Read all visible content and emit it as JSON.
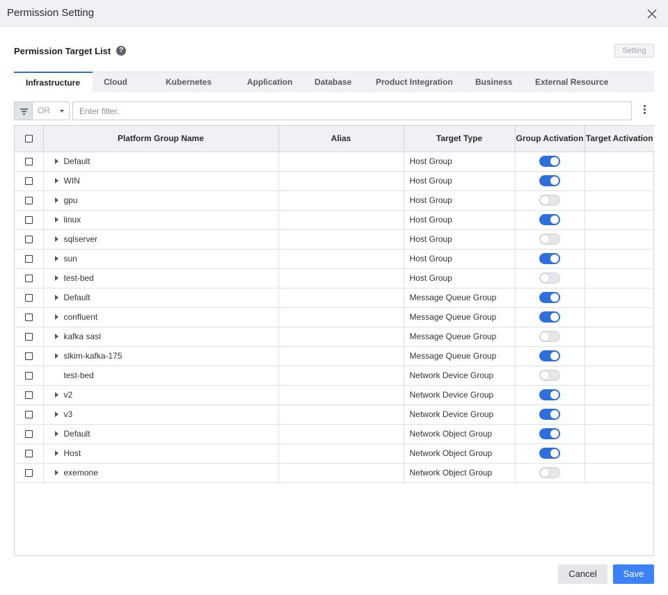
{
  "window": {
    "title": "Permission Setting"
  },
  "section": {
    "title": "Permission Target List",
    "setting_label": "Setting"
  },
  "tabs": [
    {
      "label": "Infrastructure",
      "active": true
    },
    {
      "label": "Cloud",
      "active": false
    },
    {
      "label": "Kubernetes",
      "active": false
    },
    {
      "label": "Application",
      "active": false
    },
    {
      "label": "Database",
      "active": false
    },
    {
      "label": "Product Integration",
      "active": false
    },
    {
      "label": "Business",
      "active": false
    },
    {
      "label": "External Resource",
      "active": false
    }
  ],
  "filter": {
    "operator": "OR",
    "placeholder": "Enter filter.",
    "value": ""
  },
  "table": {
    "columns": {
      "name": "Platform Group Name",
      "alias": "Alias",
      "type": "Target Type",
      "group_activation": "Group Activation",
      "target_activation": "Target Activation"
    },
    "rows": [
      {
        "name": "Default",
        "alias": "",
        "type": "Host Group",
        "group_active": true,
        "expandable": true
      },
      {
        "name": "WIN",
        "alias": "",
        "type": "Host Group",
        "group_active": true,
        "expandable": true
      },
      {
        "name": "gpu",
        "alias": "",
        "type": "Host Group",
        "group_active": false,
        "expandable": true
      },
      {
        "name": "linux",
        "alias": "",
        "type": "Host Group",
        "group_active": true,
        "expandable": true
      },
      {
        "name": "sqlserver",
        "alias": "",
        "type": "Host Group",
        "group_active": false,
        "expandable": true
      },
      {
        "name": "sun",
        "alias": "",
        "type": "Host Group",
        "group_active": true,
        "expandable": true
      },
      {
        "name": "test-bed",
        "alias": "",
        "type": "Host Group",
        "group_active": false,
        "expandable": true
      },
      {
        "name": "Default",
        "alias": "",
        "type": "Message Queue Group",
        "group_active": true,
        "expandable": true
      },
      {
        "name": "confluent",
        "alias": "",
        "type": "Message Queue Group",
        "group_active": true,
        "expandable": true
      },
      {
        "name": "kafka sasl",
        "alias": "",
        "type": "Message Queue Group",
        "group_active": false,
        "expandable": true
      },
      {
        "name": "slkim-kafka-175",
        "alias": "",
        "type": "Message Queue Group",
        "group_active": true,
        "expandable": true
      },
      {
        "name": "test-bed",
        "alias": "",
        "type": "Network Device Group",
        "group_active": false,
        "expandable": false
      },
      {
        "name": "v2",
        "alias": "",
        "type": "Network Device Group",
        "group_active": true,
        "expandable": true
      },
      {
        "name": "v3",
        "alias": "",
        "type": "Network Device Group",
        "group_active": true,
        "expandable": true
      },
      {
        "name": "Default",
        "alias": "",
        "type": "Network Object Group",
        "group_active": true,
        "expandable": true
      },
      {
        "name": "Host",
        "alias": "",
        "type": "Network Object Group",
        "group_active": true,
        "expandable": true
      },
      {
        "name": "exemone",
        "alias": "",
        "type": "Network Object Group",
        "group_active": false,
        "expandable": true
      }
    ]
  },
  "footer": {
    "cancel_label": "Cancel",
    "save_label": "Save"
  },
  "colors": {
    "accent": "#2f6fdc",
    "save": "#3b82f6",
    "header_bg": "#eff1f4"
  }
}
